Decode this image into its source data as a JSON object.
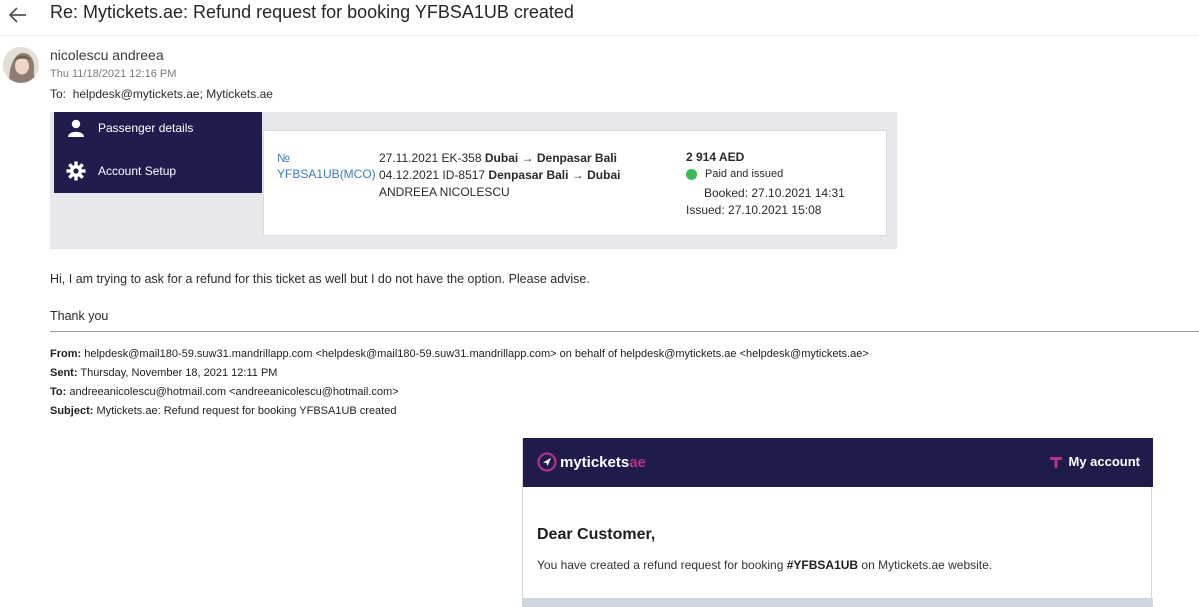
{
  "email": {
    "subject": "Re: Mytickets.ae: Refund request for booking YFBSA1UB created",
    "sender": "nicolescu andreea",
    "date": "Thu 11/18/2021 12:16 PM",
    "to_label": "To:",
    "to_value": "helpdesk@mytickets.ae; Mytickets.ae"
  },
  "screenshot": {
    "nav": [
      {
        "label": "Passenger details",
        "icon": "person-icon"
      },
      {
        "label": "Account Setup",
        "icon": "gear-icon"
      }
    ],
    "booking": {
      "number_label": "№",
      "code": "YFBSA1UB(MCO)",
      "route1_prefix": "27.11.2021 EK-358 ",
      "route1_bold": "Dubai → Denpasar Bali",
      "route2_prefix": "04.12.2021 ID-8517 ",
      "route2_bold": "Denpasar Bali → Dubai",
      "passenger": "ANDREEA NICOLESCU",
      "price": "2 914 AED",
      "status": "Paid and issued",
      "status_color": "#3cba5b",
      "booked": "Booked: 27.10.2021 14:31",
      "issued": "Issued: 27.10.2021 15:08"
    }
  },
  "message": {
    "line1": "Hi, I am trying to ask for a refund for this ticket as well but I do not have the option. Please advise.",
    "line2": "Thank you"
  },
  "forwarded": {
    "from_label": "From:",
    "from_value": " helpdesk@mail180-59.suw31.mandrillapp.com <helpdesk@mail180-59.suw31.mandrillapp.com> on behalf of helpdesk@mytickets.ae <helpdesk@mytickets.ae>",
    "sent_label": "Sent:",
    "sent_value": " Thursday, November 18, 2021 12:11 PM",
    "to_label": "To:",
    "to_value": " andreeanicolescu@hotmail.com <andreeanicolescu@hotmail.com>",
    "subject_label": "Subject:",
    "subject_value": " Mytickets.ae: Refund request for booking YFBSA1UB created"
  },
  "newsletter": {
    "logo_main": "mytickets",
    "logo_suffix": "ae",
    "my_account": "My account",
    "greeting": "Dear Customer,",
    "text_before": "You have created a refund request for booking ",
    "booking_ref": "#YFBSA1UB",
    "text_after": " on Mytickets.ae website.",
    "brand_dark": "#1f1c4b",
    "brand_accent": "#b4338a"
  }
}
